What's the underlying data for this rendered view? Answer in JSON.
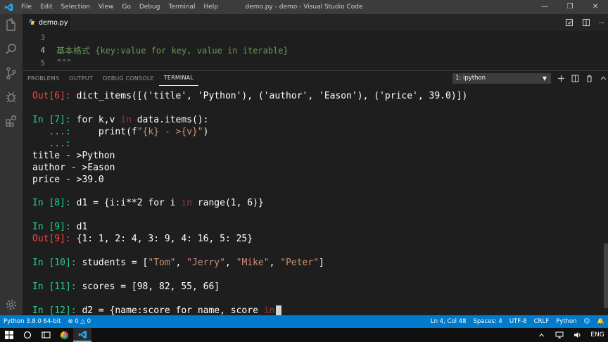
{
  "window": {
    "title": "demo.py - demo - Visual Studio Code",
    "menu": [
      "File",
      "Edit",
      "Selection",
      "View",
      "Go",
      "Debug",
      "Terminal",
      "Help"
    ]
  },
  "tab": {
    "label": "demo.py"
  },
  "editor": {
    "lines": [
      {
        "number": "3",
        "text": ""
      },
      {
        "number": "4",
        "text": "基本格式 {key:value for key, value in iterable}"
      },
      {
        "number": "5",
        "text": "\"\"\""
      }
    ]
  },
  "panel": {
    "tabs": [
      "PROBLEMS",
      "OUTPUT",
      "DEBUG CONSOLE",
      "TERMINAL"
    ],
    "terminal_select": "1: ipython"
  },
  "terminal": {
    "l1_prompt": "Out[6]: ",
    "l1_text": "dict_items([('title', 'Python'), ('author', 'Eason'), ('price', 39.0)])",
    "l2_prompt": "In [7]: ",
    "l2_a": "for k,v ",
    "l2_kw": "in",
    "l2_b": " data.items():",
    "l3_prompt": "   ...: ",
    "l3_a": "    print(f",
    "l3_str": "\"{k} - >{v}\"",
    "l3_b": ")",
    "l4_prompt": "   ...:",
    "l5": "title - >Python",
    "l6": "author - >Eason",
    "l7": "price - >39.0",
    "l8_prompt": "In [8]: ",
    "l8_a": "d1 = {i:i**2 for i ",
    "l8_kw": "in",
    "l8_b": " range(1, 6)}",
    "l9_prompt": "In [9]: ",
    "l9_a": "d1",
    "l10_prompt": "Out[9]: ",
    "l10_text": "{1: 1, 2: 4, 3: 9, 4: 16, 5: 25}",
    "l11_prompt": "In [10]: ",
    "l11_a": "students = [",
    "l11_s1": "\"Tom\"",
    "l11_s2": "\"Jerry\"",
    "l11_s3": "\"Mike\"",
    "l11_s4": "\"Peter\"",
    "l11_sep": ", ",
    "l11_end": "]",
    "l12_prompt": "In [11]: ",
    "l12_a": "scores = [98, 82, 55, 66]",
    "l13_prompt": "In [12]: ",
    "l13_a": "d2 = {name:score for name, score ",
    "l13_kw": "in"
  },
  "status": {
    "python": "Python 3.8.0 64-bit",
    "errors": "0",
    "warnings": "0",
    "position": "Ln 4, Col 48",
    "spaces": "Spaces: 4",
    "encoding": "UTF-8",
    "eol": "CRLF",
    "language": "Python"
  },
  "taskbar": {
    "lang": "ENG"
  },
  "colors": {
    "accent": "#007acc",
    "prompt_in": "#23d18b",
    "prompt_out": "#f44747",
    "string": "#ce9178",
    "comment": "#6a9955"
  }
}
